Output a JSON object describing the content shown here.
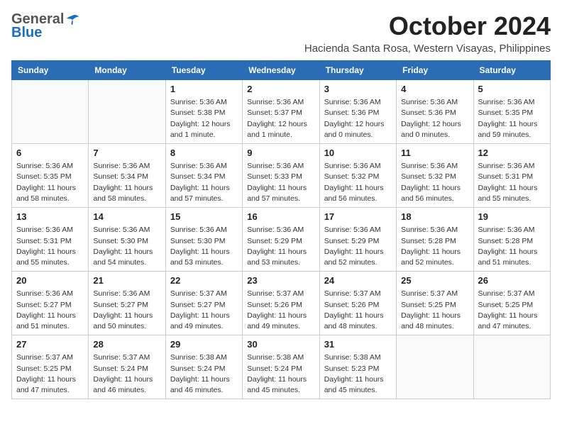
{
  "header": {
    "logo_general": "General",
    "logo_blue": "Blue",
    "month_title": "October 2024",
    "location": "Hacienda Santa Rosa, Western Visayas, Philippines"
  },
  "weekdays": [
    "Sunday",
    "Monday",
    "Tuesday",
    "Wednesday",
    "Thursday",
    "Friday",
    "Saturday"
  ],
  "weeks": [
    [
      {
        "day": "",
        "sunrise": "",
        "sunset": "",
        "daylight": "",
        "empty": true
      },
      {
        "day": "",
        "sunrise": "",
        "sunset": "",
        "daylight": "",
        "empty": true
      },
      {
        "day": "1",
        "sunrise": "Sunrise: 5:36 AM",
        "sunset": "Sunset: 5:38 PM",
        "daylight": "Daylight: 12 hours and 1 minute."
      },
      {
        "day": "2",
        "sunrise": "Sunrise: 5:36 AM",
        "sunset": "Sunset: 5:37 PM",
        "daylight": "Daylight: 12 hours and 1 minute."
      },
      {
        "day": "3",
        "sunrise": "Sunrise: 5:36 AM",
        "sunset": "Sunset: 5:36 PM",
        "daylight": "Daylight: 12 hours and 0 minutes."
      },
      {
        "day": "4",
        "sunrise": "Sunrise: 5:36 AM",
        "sunset": "Sunset: 5:36 PM",
        "daylight": "Daylight: 12 hours and 0 minutes."
      },
      {
        "day": "5",
        "sunrise": "Sunrise: 5:36 AM",
        "sunset": "Sunset: 5:35 PM",
        "daylight": "Daylight: 11 hours and 59 minutes."
      }
    ],
    [
      {
        "day": "6",
        "sunrise": "Sunrise: 5:36 AM",
        "sunset": "Sunset: 5:35 PM",
        "daylight": "Daylight: 11 hours and 58 minutes."
      },
      {
        "day": "7",
        "sunrise": "Sunrise: 5:36 AM",
        "sunset": "Sunset: 5:34 PM",
        "daylight": "Daylight: 11 hours and 58 minutes."
      },
      {
        "day": "8",
        "sunrise": "Sunrise: 5:36 AM",
        "sunset": "Sunset: 5:34 PM",
        "daylight": "Daylight: 11 hours and 57 minutes."
      },
      {
        "day": "9",
        "sunrise": "Sunrise: 5:36 AM",
        "sunset": "Sunset: 5:33 PM",
        "daylight": "Daylight: 11 hours and 57 minutes."
      },
      {
        "day": "10",
        "sunrise": "Sunrise: 5:36 AM",
        "sunset": "Sunset: 5:32 PM",
        "daylight": "Daylight: 11 hours and 56 minutes."
      },
      {
        "day": "11",
        "sunrise": "Sunrise: 5:36 AM",
        "sunset": "Sunset: 5:32 PM",
        "daylight": "Daylight: 11 hours and 56 minutes."
      },
      {
        "day": "12",
        "sunrise": "Sunrise: 5:36 AM",
        "sunset": "Sunset: 5:31 PM",
        "daylight": "Daylight: 11 hours and 55 minutes."
      }
    ],
    [
      {
        "day": "13",
        "sunrise": "Sunrise: 5:36 AM",
        "sunset": "Sunset: 5:31 PM",
        "daylight": "Daylight: 11 hours and 55 minutes."
      },
      {
        "day": "14",
        "sunrise": "Sunrise: 5:36 AM",
        "sunset": "Sunset: 5:30 PM",
        "daylight": "Daylight: 11 hours and 54 minutes."
      },
      {
        "day": "15",
        "sunrise": "Sunrise: 5:36 AM",
        "sunset": "Sunset: 5:30 PM",
        "daylight": "Daylight: 11 hours and 53 minutes."
      },
      {
        "day": "16",
        "sunrise": "Sunrise: 5:36 AM",
        "sunset": "Sunset: 5:29 PM",
        "daylight": "Daylight: 11 hours and 53 minutes."
      },
      {
        "day": "17",
        "sunrise": "Sunrise: 5:36 AM",
        "sunset": "Sunset: 5:29 PM",
        "daylight": "Daylight: 11 hours and 52 minutes."
      },
      {
        "day": "18",
        "sunrise": "Sunrise: 5:36 AM",
        "sunset": "Sunset: 5:28 PM",
        "daylight": "Daylight: 11 hours and 52 minutes."
      },
      {
        "day": "19",
        "sunrise": "Sunrise: 5:36 AM",
        "sunset": "Sunset: 5:28 PM",
        "daylight": "Daylight: 11 hours and 51 minutes."
      }
    ],
    [
      {
        "day": "20",
        "sunrise": "Sunrise: 5:36 AM",
        "sunset": "Sunset: 5:27 PM",
        "daylight": "Daylight: 11 hours and 51 minutes."
      },
      {
        "day": "21",
        "sunrise": "Sunrise: 5:36 AM",
        "sunset": "Sunset: 5:27 PM",
        "daylight": "Daylight: 11 hours and 50 minutes."
      },
      {
        "day": "22",
        "sunrise": "Sunrise: 5:37 AM",
        "sunset": "Sunset: 5:27 PM",
        "daylight": "Daylight: 11 hours and 49 minutes."
      },
      {
        "day": "23",
        "sunrise": "Sunrise: 5:37 AM",
        "sunset": "Sunset: 5:26 PM",
        "daylight": "Daylight: 11 hours and 49 minutes."
      },
      {
        "day": "24",
        "sunrise": "Sunrise: 5:37 AM",
        "sunset": "Sunset: 5:26 PM",
        "daylight": "Daylight: 11 hours and 48 minutes."
      },
      {
        "day": "25",
        "sunrise": "Sunrise: 5:37 AM",
        "sunset": "Sunset: 5:25 PM",
        "daylight": "Daylight: 11 hours and 48 minutes."
      },
      {
        "day": "26",
        "sunrise": "Sunrise: 5:37 AM",
        "sunset": "Sunset: 5:25 PM",
        "daylight": "Daylight: 11 hours and 47 minutes."
      }
    ],
    [
      {
        "day": "27",
        "sunrise": "Sunrise: 5:37 AM",
        "sunset": "Sunset: 5:25 PM",
        "daylight": "Daylight: 11 hours and 47 minutes."
      },
      {
        "day": "28",
        "sunrise": "Sunrise: 5:37 AM",
        "sunset": "Sunset: 5:24 PM",
        "daylight": "Daylight: 11 hours and 46 minutes."
      },
      {
        "day": "29",
        "sunrise": "Sunrise: 5:38 AM",
        "sunset": "Sunset: 5:24 PM",
        "daylight": "Daylight: 11 hours and 46 minutes."
      },
      {
        "day": "30",
        "sunrise": "Sunrise: 5:38 AM",
        "sunset": "Sunset: 5:24 PM",
        "daylight": "Daylight: 11 hours and 45 minutes."
      },
      {
        "day": "31",
        "sunrise": "Sunrise: 5:38 AM",
        "sunset": "Sunset: 5:23 PM",
        "daylight": "Daylight: 11 hours and 45 minutes."
      },
      {
        "day": "",
        "sunrise": "",
        "sunset": "",
        "daylight": "",
        "empty": true
      },
      {
        "day": "",
        "sunrise": "",
        "sunset": "",
        "daylight": "",
        "empty": true
      }
    ]
  ]
}
